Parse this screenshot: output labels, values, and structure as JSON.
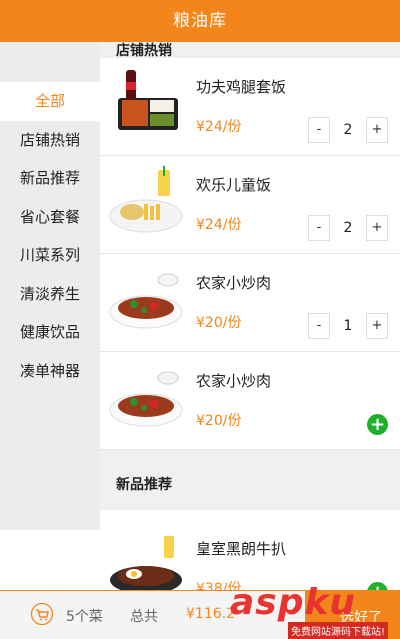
{
  "app": {
    "title": "粮油库"
  },
  "sidebar": {
    "items": [
      {
        "label": "全部",
        "active": true
      },
      {
        "label": "店铺热销"
      },
      {
        "label": "新品推荐"
      },
      {
        "label": "省心套餐"
      },
      {
        "label": "川菜系列"
      },
      {
        "label": "清淡养生"
      },
      {
        "label": "健康饮品"
      },
      {
        "label": "凑单神器"
      }
    ]
  },
  "sections": [
    {
      "title": "店铺热销",
      "items": [
        {
          "name": "功夫鸡腿套饭",
          "price": "¥24/份",
          "qty": "2",
          "image": "chicken-set-meal"
        },
        {
          "name": "欢乐儿童饭",
          "price": "¥24/份",
          "qty": "2",
          "image": "kids-meal"
        },
        {
          "name": "农家小炒肉",
          "price": "¥20/份",
          "qty": "1",
          "image": "stir-fried-pork"
        },
        {
          "name": "农家小炒肉",
          "price": "¥20/份",
          "image": "stir-fried-pork"
        }
      ]
    },
    {
      "title": "新品推荐",
      "items": [
        {
          "name": "皇室黑朗牛扒",
          "price": "¥38/份",
          "image": "steak-plate"
        }
      ]
    }
  ],
  "stepper": {
    "minus": "-",
    "plus": "+"
  },
  "add": "+",
  "bottom": {
    "count": "5个菜",
    "total_label": "总共",
    "total_amount": "¥116.2",
    "checkout": "选好了"
  },
  "watermark": {
    "text": "aspku",
    "sub": "免费网站源码下载站!"
  },
  "colors": {
    "accent": "#f3861a",
    "add": "#1fb12b"
  }
}
